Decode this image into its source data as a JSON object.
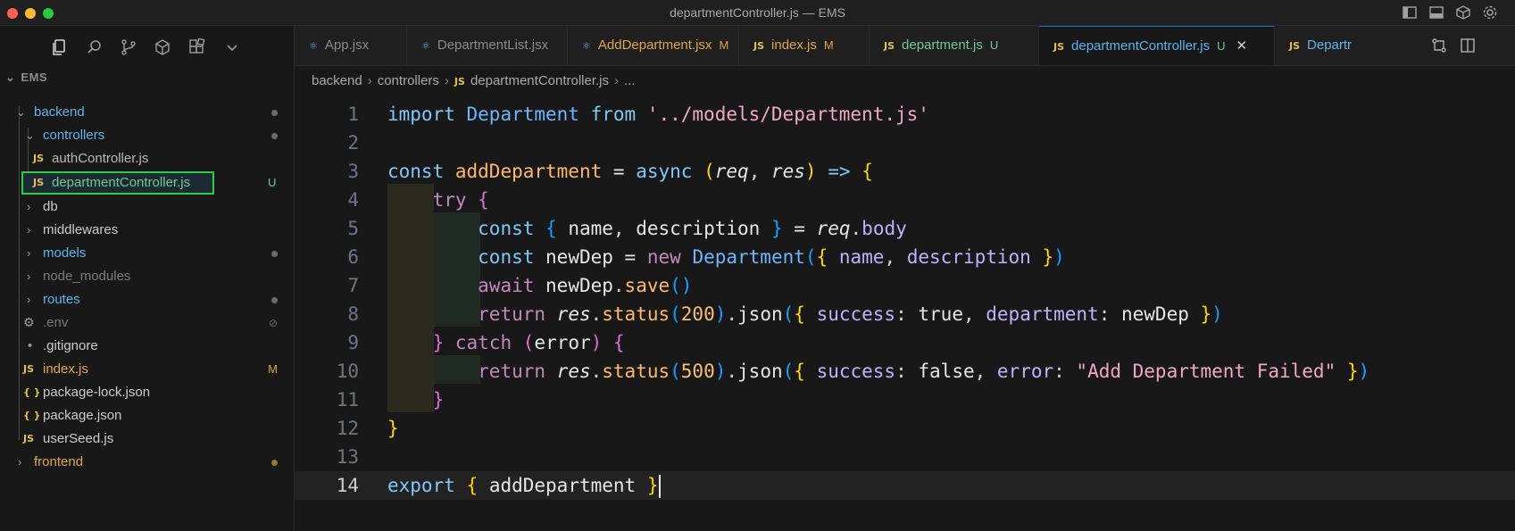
{
  "window": {
    "title": "departmentController.js — EMS"
  },
  "explorer": {
    "root": "EMS",
    "items": [
      {
        "name": "backend",
        "kind": "folder-open"
      },
      {
        "name": "controllers",
        "kind": "folder-open"
      },
      {
        "name": "authController.js",
        "kind": "js",
        "icon_text": "JS"
      },
      {
        "name": "departmentController.js",
        "kind": "js",
        "icon_text": "JS",
        "badge": "U"
      },
      {
        "name": "db",
        "kind": "folder"
      },
      {
        "name": "middlewares",
        "kind": "folder"
      },
      {
        "name": "models",
        "kind": "folder"
      },
      {
        "name": "node_modules",
        "kind": "folder"
      },
      {
        "name": "routes",
        "kind": "folder"
      },
      {
        "name": ".env",
        "kind": "gear"
      },
      {
        "name": ".gitignore",
        "kind": "plain"
      },
      {
        "name": "index.js",
        "kind": "js",
        "icon_text": "JS",
        "badge": "M"
      },
      {
        "name": "package-lock.json",
        "kind": "json",
        "icon_text": "{ }"
      },
      {
        "name": "package.json",
        "kind": "json",
        "icon_text": "{ }"
      },
      {
        "name": "userSeed.js",
        "kind": "js",
        "icon_text": "JS"
      },
      {
        "name": "frontend",
        "kind": "folder"
      }
    ]
  },
  "tabs": [
    {
      "label": "App.jsx",
      "badge": ""
    },
    {
      "label": "DepartmentList.jsx",
      "badge": ""
    },
    {
      "label": "AddDepartment.jsx",
      "badge": "M"
    },
    {
      "label": "index.js",
      "badge": "M",
      "icon_text": "JS"
    },
    {
      "label": "department.js",
      "badge": "U",
      "icon_text": "JS"
    },
    {
      "label": "departmentController.js",
      "badge": "U",
      "icon_text": "JS",
      "active": true
    },
    {
      "label": "Departr",
      "badge": "",
      "icon_text": "JS"
    }
  ],
  "breadcrumb": {
    "parts": [
      "backend",
      "controllers",
      "departmentController.js",
      "..."
    ],
    "file_icon": "JS"
  },
  "editor": {
    "line_numbers": [
      "1",
      "2",
      "3",
      "4",
      "5",
      "6",
      "7",
      "8",
      "9",
      "10",
      "11",
      "12",
      "13",
      "14"
    ],
    "current_line": 14,
    "lines": [
      "import Department from '../models/Department.js'",
      "",
      "const addDepartment = async (req, res) => {",
      "    try {",
      "        const { name, description } = req.body",
      "        const newDep = new Department({ name, description })",
      "        await newDep.save()",
      "        return res.status(200).json({ success: true, department: newDep })",
      "    } catch (error) {",
      "        return res.status(500).json({ success: false, error: \"Add Department Failed\" })",
      "    }",
      "}",
      "",
      "export { addDepartment }"
    ]
  },
  "colors": {
    "accent": "#0078d4",
    "selection_outline": "#2ecc40",
    "modified": "#e2a64a",
    "untracked": "#73c991"
  },
  "icons": [
    "explorer-icon",
    "search-icon",
    "source-control-icon",
    "extensions-icon",
    "remote-icon",
    "chevron-down-icon",
    "sidebar-toggle-icon",
    "panel-toggle-icon",
    "box-icon",
    "gear-icon",
    "split-editor-icon",
    "compare-icon",
    "close-icon"
  ]
}
